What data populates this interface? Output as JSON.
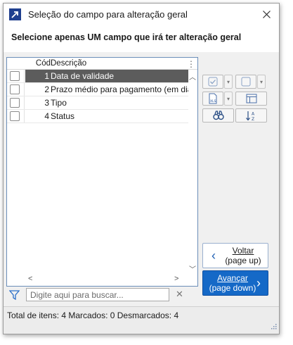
{
  "window": {
    "title": "Seleção do campo para alteração geral",
    "instruction": "Selecione apenas UM campo que irá ter alteração geral"
  },
  "grid": {
    "columns": [
      "Cód",
      "Descrição"
    ],
    "rows": [
      {
        "cod": "1",
        "descricao": "Data de validade",
        "selected": true
      },
      {
        "cod": "2",
        "descricao": "Prazo médio para pagamento (em dias)",
        "selected": false
      },
      {
        "cod": "3",
        "descricao": "Tipo",
        "selected": false
      },
      {
        "cod": "4",
        "descricao": "Status",
        "selected": false
      }
    ]
  },
  "search": {
    "placeholder": "Digite aqui para buscar..."
  },
  "toolbar": {
    "icons": [
      "check-all-icon",
      "uncheck-all-icon",
      "export-xls-icon",
      "layout-icon",
      "find-icon",
      "sort-az-icon"
    ]
  },
  "buttons": {
    "voltar_line1": "Voltar",
    "voltar_line2": "(page up)",
    "avancar_line1": "Avançar",
    "avancar_line2": "(page down)"
  },
  "status": {
    "text": "Total de itens: 4 Marcados: 0 Desmarcados: 4"
  },
  "colors": {
    "accent": "#1569c7",
    "selected_row": "#5c5c5c",
    "grid_border": "#6a8db8"
  }
}
